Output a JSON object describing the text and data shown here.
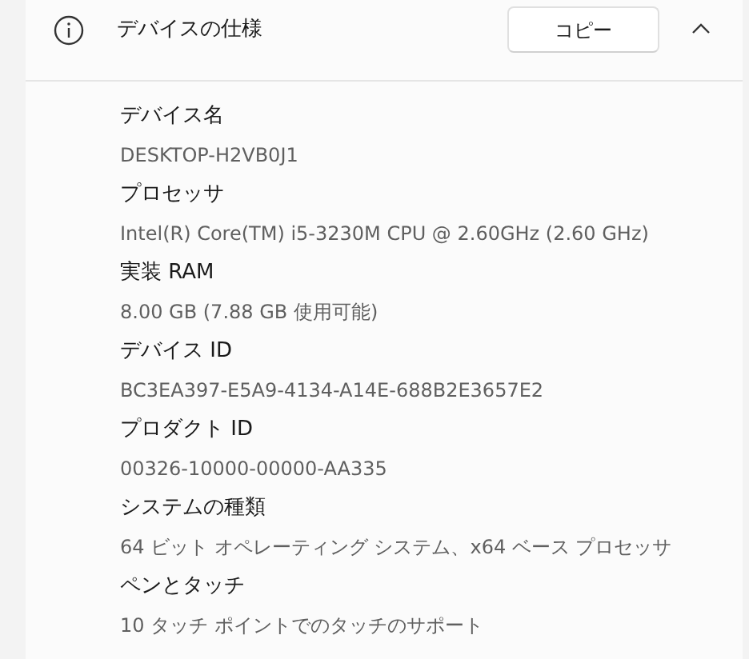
{
  "section": {
    "title": "デバイスの仕様",
    "copy_button": "コピー",
    "expanded": true
  },
  "specs": [
    {
      "label": "デバイス名",
      "value": "DESKTOP-H2VB0J1"
    },
    {
      "label": "プロセッサ",
      "value": "Intel(R) Core(TM) i5-3230M CPU @ 2.60GHz (2.60 GHz)"
    },
    {
      "label": "実装 RAM",
      "value": "8.00 GB (7.88 GB 使用可能)"
    },
    {
      "label": "デバイス ID",
      "value": "BC3EA397-E5A9-4134-A14E-688B2E3657E2"
    },
    {
      "label": "プロダクト ID",
      "value": "00326-10000-00000-AA335"
    },
    {
      "label": "システムの種類",
      "value": "64 ビット オペレーティング システム、x64 ベース プロセッサ"
    },
    {
      "label": "ペンとタッチ",
      "value": "10 タッチ ポイントでのタッチのサポート"
    }
  ]
}
